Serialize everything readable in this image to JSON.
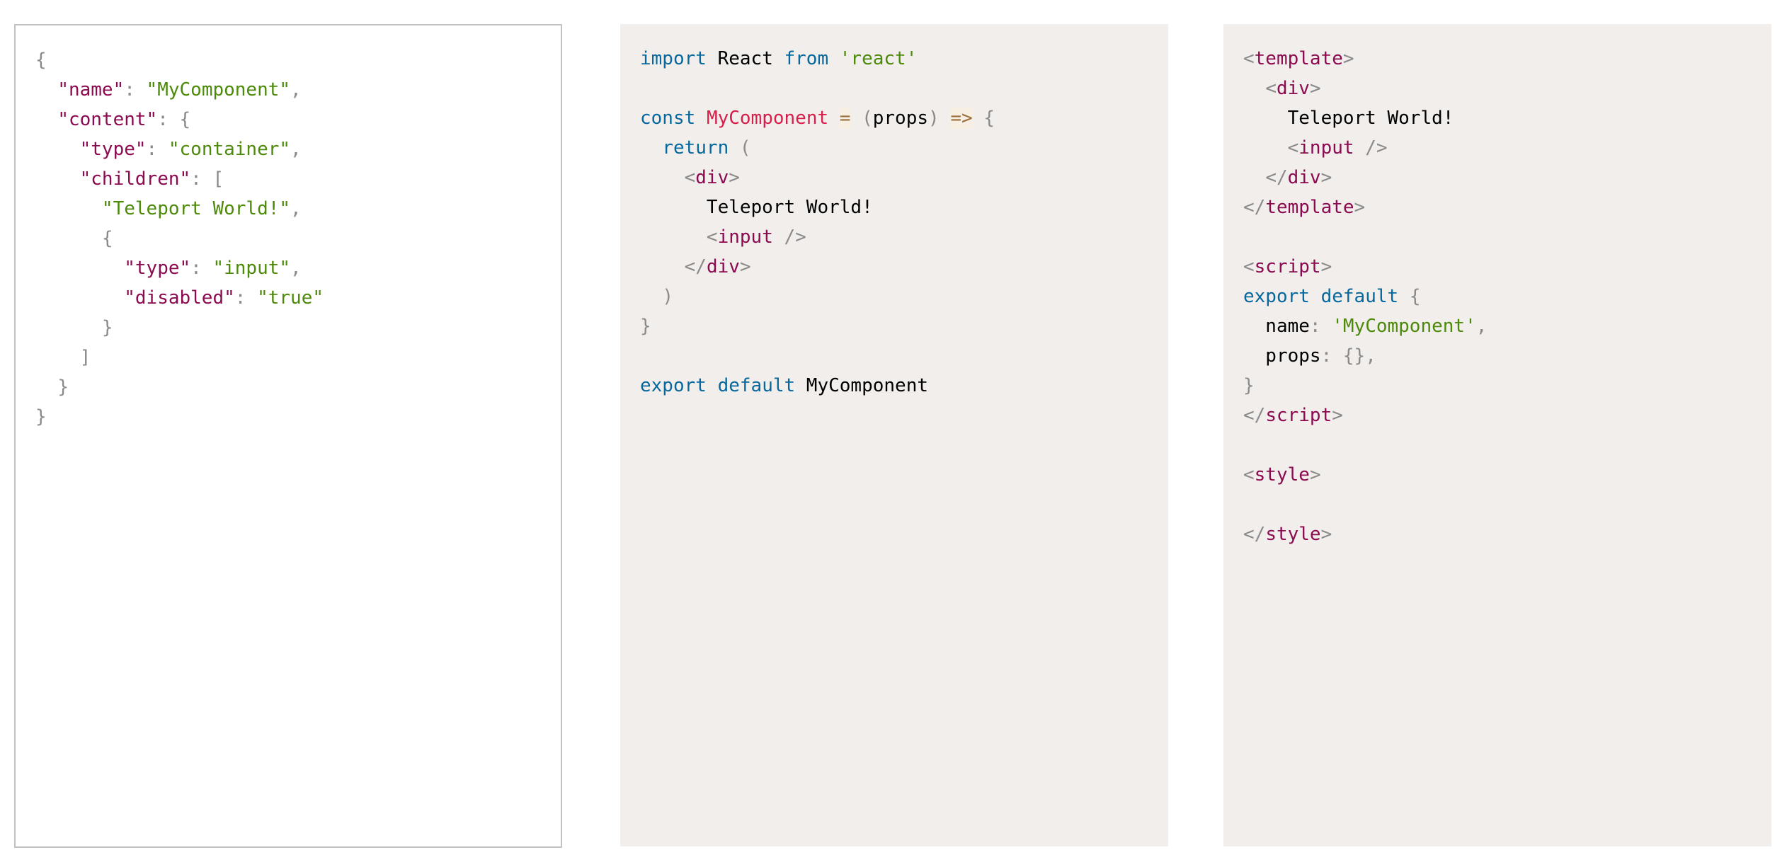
{
  "colors": {
    "punct": "#8a8a8a",
    "key": "#8b0a50",
    "string": "#4c8a0a",
    "keyword": "#07689e",
    "function_name": "#d61f4a",
    "operator": "#9a6e3a",
    "tag": "#8b0a50",
    "plain": "#000000",
    "panel_background": "#f2eeeb",
    "panel_border": "#c2c2c2"
  },
  "panels": [
    {
      "name": "json-code-panel",
      "lines": [
        [
          [
            "punct",
            "{"
          ]
        ],
        [
          [
            "plain",
            "  "
          ],
          [
            "key",
            "\"name\""
          ],
          [
            "punct",
            ": "
          ],
          [
            "str",
            "\"MyComponent\""
          ],
          [
            "punct",
            ","
          ]
        ],
        [
          [
            "plain",
            "  "
          ],
          [
            "key",
            "\"content\""
          ],
          [
            "punct",
            ": {"
          ]
        ],
        [
          [
            "plain",
            "    "
          ],
          [
            "key",
            "\"type\""
          ],
          [
            "punct",
            ": "
          ],
          [
            "str",
            "\"container\""
          ],
          [
            "punct",
            ","
          ]
        ],
        [
          [
            "plain",
            "    "
          ],
          [
            "key",
            "\"children\""
          ],
          [
            "punct",
            ": ["
          ]
        ],
        [
          [
            "plain",
            "      "
          ],
          [
            "str",
            "\"Teleport World!\""
          ],
          [
            "punct",
            ","
          ]
        ],
        [
          [
            "plain",
            "      "
          ],
          [
            "punct",
            "{"
          ]
        ],
        [
          [
            "plain",
            "        "
          ],
          [
            "key",
            "\"type\""
          ],
          [
            "punct",
            ": "
          ],
          [
            "str",
            "\"input\""
          ],
          [
            "punct",
            ","
          ]
        ],
        [
          [
            "plain",
            "        "
          ],
          [
            "key",
            "\"disabled\""
          ],
          [
            "punct",
            ": "
          ],
          [
            "str",
            "\"true\""
          ]
        ],
        [
          [
            "plain",
            "      "
          ],
          [
            "punct",
            "}"
          ]
        ],
        [
          [
            "plain",
            "    "
          ],
          [
            "punct",
            "]"
          ]
        ],
        [
          [
            "plain",
            "  "
          ],
          [
            "punct",
            "}"
          ]
        ],
        [
          [
            "punct",
            "}"
          ]
        ]
      ]
    },
    {
      "name": "react-code-panel",
      "lines": [
        [
          [
            "kw",
            "import"
          ],
          [
            "plain",
            " React "
          ],
          [
            "kw",
            "from"
          ],
          [
            "plain",
            " "
          ],
          [
            "str",
            "'react'"
          ]
        ],
        [],
        [
          [
            "kw",
            "const"
          ],
          [
            "plain",
            " "
          ],
          [
            "fn",
            "MyComponent"
          ],
          [
            "plain",
            " "
          ],
          [
            "op",
            "="
          ],
          [
            "plain",
            " "
          ],
          [
            "punct",
            "("
          ],
          [
            "plain",
            "props"
          ],
          [
            "punct",
            ")"
          ],
          [
            "plain",
            " "
          ],
          [
            "op",
            "=>"
          ],
          [
            "plain",
            " "
          ],
          [
            "punct",
            "{"
          ]
        ],
        [
          [
            "plain",
            "  "
          ],
          [
            "kw",
            "return"
          ],
          [
            "plain",
            " "
          ],
          [
            "punct",
            "("
          ]
        ],
        [
          [
            "plain",
            "    "
          ],
          [
            "punct",
            "<"
          ],
          [
            "tag",
            "div"
          ],
          [
            "punct",
            ">"
          ]
        ],
        [
          [
            "plain",
            "      Teleport World!"
          ]
        ],
        [
          [
            "plain",
            "      "
          ],
          [
            "punct",
            "<"
          ],
          [
            "tag",
            "input"
          ],
          [
            "plain",
            " "
          ],
          [
            "punct",
            "/>"
          ]
        ],
        [
          [
            "plain",
            "    "
          ],
          [
            "punct",
            "</"
          ],
          [
            "tag",
            "div"
          ],
          [
            "punct",
            ">"
          ]
        ],
        [
          [
            "plain",
            "  "
          ],
          [
            "punct",
            ")"
          ]
        ],
        [
          [
            "punct",
            "}"
          ]
        ],
        [],
        [
          [
            "kw",
            "export"
          ],
          [
            "plain",
            " "
          ],
          [
            "kw",
            "default"
          ],
          [
            "plain",
            " MyComponent"
          ]
        ]
      ]
    },
    {
      "name": "vue-code-panel",
      "lines": [
        [
          [
            "punct",
            "<"
          ],
          [
            "tag",
            "template"
          ],
          [
            "punct",
            ">"
          ]
        ],
        [
          [
            "plain",
            "  "
          ],
          [
            "punct",
            "<"
          ],
          [
            "tag",
            "div"
          ],
          [
            "punct",
            ">"
          ]
        ],
        [
          [
            "plain",
            "    Teleport World!"
          ]
        ],
        [
          [
            "plain",
            "    "
          ],
          [
            "punct",
            "<"
          ],
          [
            "tag",
            "input"
          ],
          [
            "plain",
            " "
          ],
          [
            "punct",
            "/>"
          ]
        ],
        [
          [
            "plain",
            "  "
          ],
          [
            "punct",
            "</"
          ],
          [
            "tag",
            "div"
          ],
          [
            "punct",
            ">"
          ]
        ],
        [
          [
            "punct",
            "</"
          ],
          [
            "tag",
            "template"
          ],
          [
            "punct",
            ">"
          ]
        ],
        [],
        [
          [
            "punct",
            "<"
          ],
          [
            "tag",
            "script"
          ],
          [
            "punct",
            ">"
          ]
        ],
        [
          [
            "kw",
            "export"
          ],
          [
            "plain",
            " "
          ],
          [
            "kw",
            "default"
          ],
          [
            "plain",
            " "
          ],
          [
            "punct",
            "{"
          ]
        ],
        [
          [
            "plain",
            "  name"
          ],
          [
            "punct",
            ": "
          ],
          [
            "str",
            "'MyComponent'"
          ],
          [
            "punct",
            ","
          ]
        ],
        [
          [
            "plain",
            "  props"
          ],
          [
            "punct",
            ": {},"
          ]
        ],
        [
          [
            "punct",
            "}"
          ]
        ],
        [
          [
            "punct",
            "</"
          ],
          [
            "tag",
            "script"
          ],
          [
            "punct",
            ">"
          ]
        ],
        [],
        [
          [
            "punct",
            "<"
          ],
          [
            "tag",
            "style"
          ],
          [
            "punct",
            ">"
          ]
        ],
        [],
        [
          [
            "punct",
            "</"
          ],
          [
            "tag",
            "style"
          ],
          [
            "punct",
            ">"
          ]
        ]
      ]
    }
  ]
}
